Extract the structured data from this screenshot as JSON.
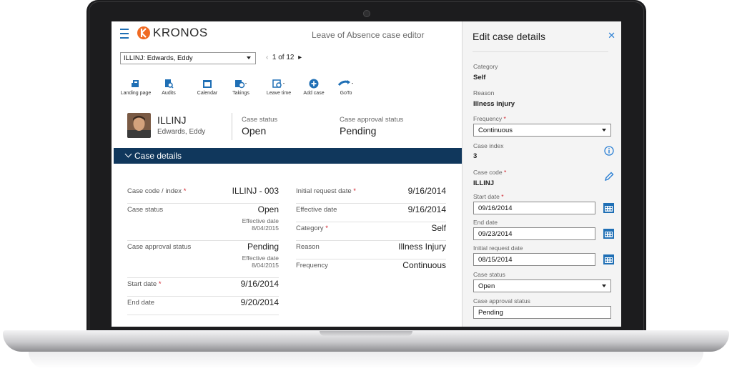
{
  "app": {
    "brand": "KRONOS",
    "title": "Leave of Absence case editor"
  },
  "employee_select": {
    "value": "ILLINJ: Edwards, Eddy"
  },
  "pager": {
    "current": "1",
    "of_label": "of 12"
  },
  "toolbar": [
    {
      "label": "Landing page",
      "icon": "landing-page-icon"
    },
    {
      "label": "Audits",
      "icon": "audits-icon"
    },
    {
      "label": "Calendar",
      "icon": "calendar-icon"
    },
    {
      "label": "Takings",
      "icon": "takings-icon"
    },
    {
      "label": "Leave time",
      "icon": "leave-time-icon"
    },
    {
      "label": "Add case",
      "icon": "add-case-icon"
    },
    {
      "label": "GoTo",
      "icon": "goto-icon"
    }
  ],
  "case_header": {
    "id": "ILLINJ",
    "name": "Edwards, Eddy",
    "status_label": "Case status",
    "status_value": "Open",
    "approval_label": "Case approval status",
    "approval_value": "Pending"
  },
  "section": {
    "label": "Case details"
  },
  "details_left": {
    "code_label": "Case code / index",
    "code_value": "ILLINJ - 003",
    "status_label": "Case status",
    "status_value": "Open",
    "status_eff_label": "Effective date",
    "status_eff_date": "8/04/2015",
    "approval_label": "Case approval status",
    "approval_value": "Pending",
    "approval_eff_label": "Effective date",
    "approval_eff_date": "8/04/2015",
    "start_label": "Start date",
    "start_value": "9/16/2014",
    "end_label": "End date",
    "end_value": "9/20/2014"
  },
  "details_right": {
    "initial_label": "Initial request date",
    "initial_value": "9/16/2014",
    "effective_label": "Effective date",
    "effective_value": "9/16/2014",
    "category_label": "Category",
    "category_value": "Self",
    "reason_label": "Reason",
    "reason_value": "Illness Injury",
    "frequency_label": "Frequency",
    "frequency_value": "Continuous"
  },
  "required_marker": "*",
  "panel": {
    "title": "Edit case details",
    "close_icon": "close-icon",
    "category_label": "Category",
    "category_value": "Self",
    "reason_label": "Reason",
    "reason_value": "Illness injury",
    "frequency_label": "Frequency",
    "frequency_value": "Continuous",
    "index_label": "Case index",
    "index_value": "3",
    "code_label": "Case code",
    "code_value": "ILLINJ",
    "start_label": "Start date",
    "start_value": "09/16/2014",
    "end_label": "End date",
    "end_value": "09/23/2014",
    "initial_label": "Initial request date",
    "initial_value": "08/15/2014",
    "status_label": "Case status",
    "status_value": "Open",
    "approval_label": "Case approval status",
    "approval_value": "Pending"
  },
  "colors": {
    "brand_blue": "#1f6fb5",
    "section_navy": "#10375c",
    "logo_orange": "#f06a22",
    "required_red": "#d0202a"
  }
}
